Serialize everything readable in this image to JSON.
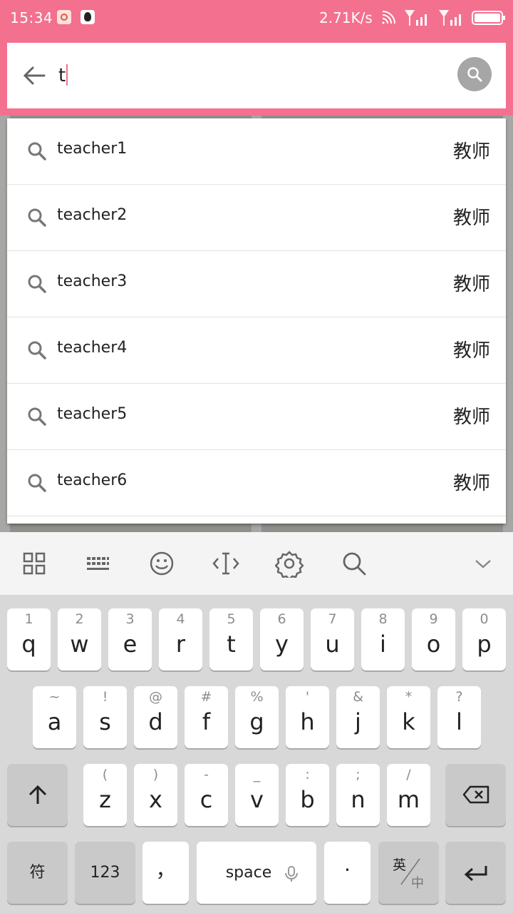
{
  "status_bar": {
    "time": "15:34",
    "net_speed": "2.71K/s"
  },
  "search": {
    "query": "t"
  },
  "suggestions": [
    {
      "name": "teacher1",
      "role": "教师"
    },
    {
      "name": "teacher2",
      "role": "教师"
    },
    {
      "name": "teacher3",
      "role": "教师"
    },
    {
      "name": "teacher4",
      "role": "教师"
    },
    {
      "name": "teacher5",
      "role": "教师"
    },
    {
      "name": "teacher6",
      "role": "教师"
    }
  ],
  "keyboard": {
    "toolbar_icons": [
      "grid-icon",
      "keyboard-icon",
      "emoji-icon",
      "cursor-icon",
      "gear-icon",
      "search-icon",
      "chevron-down-icon"
    ],
    "row1": [
      {
        "hint": "1",
        "key": "q"
      },
      {
        "hint": "2",
        "key": "w"
      },
      {
        "hint": "3",
        "key": "e"
      },
      {
        "hint": "4",
        "key": "r"
      },
      {
        "hint": "5",
        "key": "t"
      },
      {
        "hint": "6",
        "key": "y"
      },
      {
        "hint": "7",
        "key": "u"
      },
      {
        "hint": "8",
        "key": "i"
      },
      {
        "hint": "9",
        "key": "o"
      },
      {
        "hint": "0",
        "key": "p"
      }
    ],
    "row2": [
      {
        "hint": "~",
        "key": "a"
      },
      {
        "hint": "!",
        "key": "s"
      },
      {
        "hint": "@",
        "key": "d"
      },
      {
        "hint": "#",
        "key": "f"
      },
      {
        "hint": "%",
        "key": "g"
      },
      {
        "hint": "'",
        "key": "h"
      },
      {
        "hint": "&",
        "key": "j"
      },
      {
        "hint": "*",
        "key": "k"
      },
      {
        "hint": "?",
        "key": "l"
      }
    ],
    "row3": [
      {
        "hint": "(",
        "key": "z"
      },
      {
        "hint": ")",
        "key": "x"
      },
      {
        "hint": "-",
        "key": "c"
      },
      {
        "hint": "_",
        "key": "v"
      },
      {
        "hint": ":",
        "key": "b"
      },
      {
        "hint": ";",
        "key": "n"
      },
      {
        "hint": "/",
        "key": "m"
      }
    ],
    "symbol_label": "符",
    "numbers_label": "123",
    "comma_label": "，",
    "space_label": "space",
    "period_label": "·",
    "lang_top": "英",
    "lang_bottom": "中",
    "colors": {
      "accent": "#f4708f",
      "keyboard_bg": "#d8d8d8"
    }
  }
}
